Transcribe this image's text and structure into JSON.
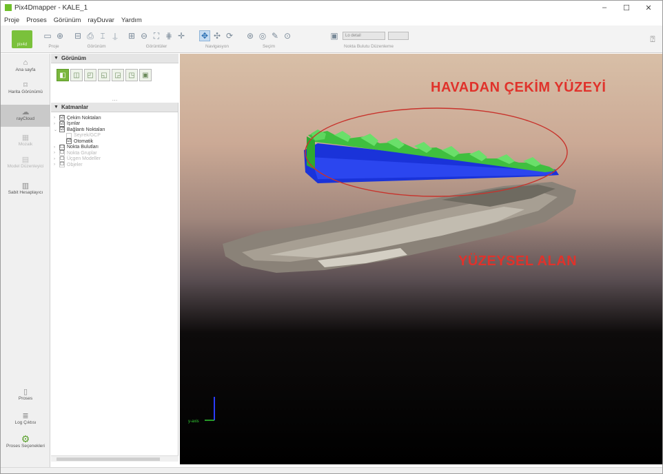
{
  "window": {
    "title": "Pix4Dmapper - KALE_1",
    "minimize": "–",
    "maximize": "☐",
    "close": "✕"
  },
  "menu": [
    "Proje",
    "Proses",
    "Görünüm",
    "rayDuvar",
    "Yardım"
  ],
  "toolbar": {
    "logo_text": "pix4d",
    "groups": [
      {
        "caption": "Proje",
        "icons": [
          "folder-open-icon",
          "save-icon"
        ]
      },
      {
        "caption": "Görünüm",
        "icons": [
          "window-icon",
          "print-icon",
          "tile-icon",
          "pin-icon"
        ]
      },
      {
        "caption": "Görüntüler",
        "icons": [
          "zoom-in-icon",
          "zoom-out-icon",
          "fit-icon",
          "grid-icon",
          "crosshair-icon"
        ]
      },
      {
        "caption": "Navigasyon",
        "icons": [
          "navigate-icon",
          "rotate-icon",
          "pan-icon"
        ]
      },
      {
        "caption": "Seçim",
        "icons": [
          "select-icon",
          "target-icon",
          "pencil-icon",
          "eye-icon"
        ]
      },
      {
        "caption": "Nokta Bulutu Düzenleme",
        "icons": [
          "layer-icon"
        ],
        "combo": "Lo detail"
      }
    ],
    "right_icon": "help-icon"
  },
  "left_rail": {
    "items": [
      {
        "label": "Ana sayfa",
        "icon": "home-icon",
        "state": "normal"
      },
      {
        "label": "Harita Görünümü",
        "icon": "map-icon",
        "state": "normal"
      },
      {
        "label": "rayCloud",
        "icon": "cloud-icon",
        "state": "active"
      },
      {
        "label": "Mozaik",
        "icon": "mosaic-icon",
        "state": "muted"
      },
      {
        "label": "Model Düzenleyici",
        "icon": "edit-icon",
        "state": "muted"
      },
      {
        "label": "Sabit Hesaplayıcı",
        "icon": "calc-icon",
        "state": "normal"
      }
    ],
    "bottom_items": [
      {
        "label": "Proses",
        "icon": "process-icon"
      },
      {
        "label": "Log Çıktısı",
        "icon": "log-icon"
      },
      {
        "label": "Proses Seçenekleri",
        "icon": "gear-icon"
      }
    ]
  },
  "view_panel": {
    "header": "Görünüm",
    "icons": [
      "perspective-view-icon",
      "front-view-icon",
      "side-view-icon",
      "top-view-icon",
      "bottom-view-icon",
      "left-view-icon",
      "right-view-icon"
    ]
  },
  "layers_panel": {
    "header": "Katmanlar",
    "rows": [
      {
        "label": "Çekim Noktaları",
        "checked": "☑",
        "child": false,
        "muted": false
      },
      {
        "label": "Işınlar",
        "checked": "☑",
        "child": false,
        "muted": false
      },
      {
        "label": "Bağlantı Noktaları",
        "checked": "☑",
        "child": false,
        "muted": false
      },
      {
        "label": "Seyrek/GCP",
        "checked": "",
        "child": true,
        "muted": true
      },
      {
        "label": "Otomatik",
        "checked": "☑",
        "child": true,
        "muted": false
      },
      {
        "label": "Nokta Bulutları",
        "checked": "☐",
        "child": false,
        "muted": false
      },
      {
        "label": "Nokta Gruplar",
        "checked": "☐",
        "child": false,
        "muted": true
      },
      {
        "label": "Üçgen Modeller",
        "checked": "☐",
        "child": false,
        "muted": true
      },
      {
        "label": "Objeler",
        "checked": "☐",
        "child": false,
        "muted": true
      }
    ]
  },
  "viewport": {
    "annotation_top": "HAVADAN ÇEKİM YÜZEYİ",
    "annotation_bottom": "YÜZEYSEL ALAN",
    "axis_label": "y-axis",
    "colors": {
      "annotation": "#e0322b",
      "camera_green": "#3fbf3f",
      "camera_blue": "#1a33d9",
      "ellipse": "#c8322b"
    }
  }
}
